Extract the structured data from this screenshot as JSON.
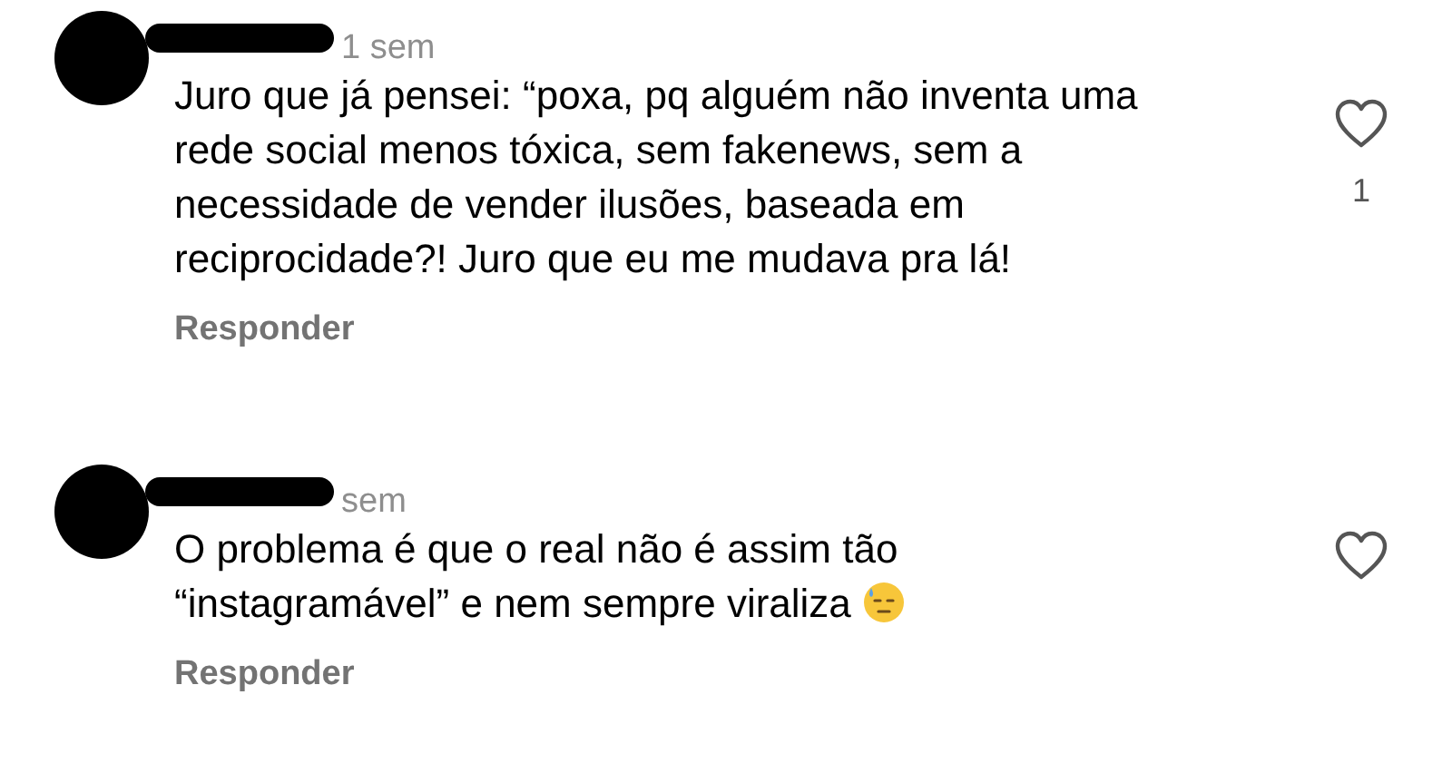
{
  "comments": [
    {
      "time": "1 sem",
      "text": "Juro que já pensei: “poxa, pq alguém não inventa uma rede social menos tóxica, sem fakenews, sem a necessidade de vender ilusões, baseada em reciprocidade?! Juro que eu me mudava pra lá!",
      "emoji": false,
      "reply": "Responder",
      "liked": false,
      "likes": "1"
    },
    {
      "time": "sem",
      "text": "O problema é que o real não é assim tão “instagramável” e nem sempre viraliza",
      "emoji": true,
      "reply": "Responder",
      "liked": false
    }
  ]
}
